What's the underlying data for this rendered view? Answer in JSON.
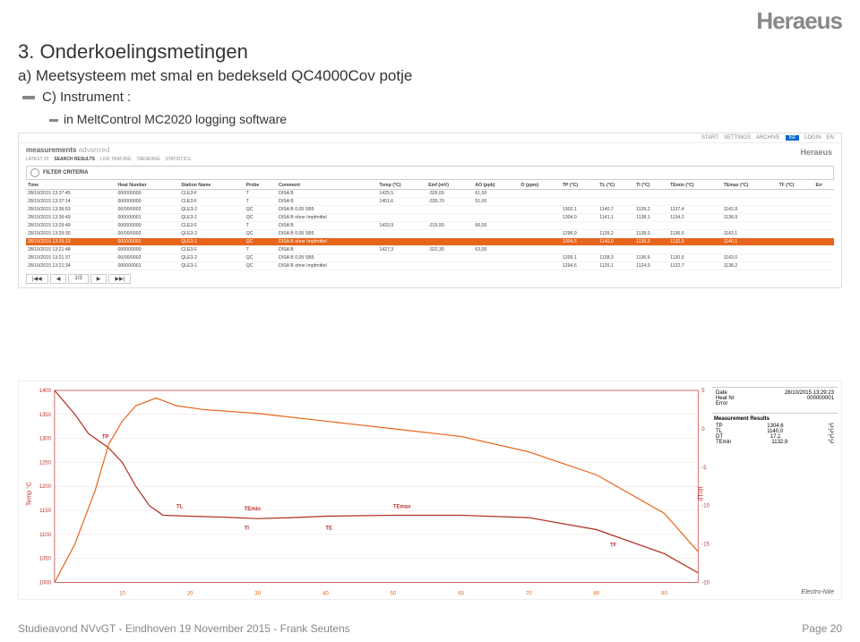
{
  "logo": "Heraeus",
  "title": "3. Onderkoelingsmetingen",
  "subtitle": "a) Meetsysteem met smal en bedekseld QC4000Cov potje",
  "bullet_c": "C) Instrument :",
  "bullet_c_sub": "in MeltControl MC2020 logging software",
  "topbar": {
    "start": "START",
    "settings": "SETTINGS",
    "archive": "ARCHIVE",
    "list": "list",
    "login": "LOGIN",
    "lang": "EN"
  },
  "breadcrumb": {
    "a": "measurements",
    "b": "advanced"
  },
  "tabs": [
    "LATEST 20",
    "SEARCH RESULTS",
    "LIVE TRACING",
    "TRENDING",
    "STATISTICS"
  ],
  "filter_label": "FILTER CRITERIA",
  "columns": [
    "Time",
    "Heat Number",
    "Station Name",
    "Probe",
    "Comment",
    "Temp (°C)",
    "Emf (mV)",
    "AO (ppb)",
    "O (ppm)",
    "TP (°C)",
    "TL (°C)",
    "TI (°C)",
    "TEmin (°C)",
    "TEmax (°C)",
    "TF (°C)",
    "Err"
  ],
  "rows": [
    {
      "time": "28/10/2015 13:37:45",
      "heat": "000000000",
      "station": "CLE3-F",
      "probe": "T",
      "comment": "DISA B",
      "temp": "1425,5",
      "emf": "-326,00",
      "ao": "61,00"
    },
    {
      "time": "28/10/2015 13:37:14",
      "heat": "000000000",
      "station": "CLE3-F",
      "probe": "T",
      "comment": "DISA B",
      "temp": "1451,6",
      "emf": "-335,70",
      "ao": "51,00"
    },
    {
      "time": "28/10/2015 13:36:53",
      "heat": "00/00/0002",
      "station": "QLE3-2",
      "probe": "QC",
      "comment": "DISA B 0,05 SB5",
      "tp": "1302,1",
      "tl": "1140,7",
      "ti": "1139,2",
      "temin": "1137,4",
      "temax": "1142,8"
    },
    {
      "time": "28/10/2015 13:36:49",
      "heat": "000000001",
      "station": "QLE3-1",
      "probe": "QC",
      "comment": "DISA B ohne Impfmittel",
      "tp": "1304,0",
      "tl": "1141,1",
      "ti": "1138,1",
      "temin": "1134,2",
      "temax": "1138,9"
    },
    {
      "time": "28/10/2015 13:29:49",
      "heat": "000000000",
      "station": "CLE3-F",
      "probe": "T",
      "comment": "DISA B",
      "temp": "1433,9",
      "emf": "-315,50",
      "ao": "66,00"
    },
    {
      "time": "28/10/2015 13:29:30",
      "heat": "00/00/0002",
      "station": "QLE3-2",
      "probe": "QC",
      "comment": "DISA B 0,05 SB5",
      "tp": "1296,9",
      "tl": "1139,2",
      "ti": "1138,0",
      "temin": "1136,6",
      "temax": "1143,1"
    },
    {
      "hl": true,
      "time": "28/10/2015 13:29:23",
      "heat": "000000001",
      "station": "QLE3-1",
      "probe": "QC",
      "comment": "DISA B ohne Impfmittel",
      "tp": "1304,5",
      "tl": "1140,0",
      "ti": "1136,9",
      "temin": "1132,9",
      "temax": "1140,1"
    },
    {
      "time": "28/10/2015 13:21:48",
      "heat": "000000000",
      "station": "CLE3-F",
      "probe": "T",
      "comment": "DISA B",
      "temp": "1427,3",
      "emf": "-322,30",
      "ao": "63,00"
    },
    {
      "time": "28/10/2015 13:21:37",
      "heat": "00/00/0002",
      "station": "QLE3-2",
      "probe": "QC",
      "comment": "DISA B 0,05 SB5",
      "tp": "1209,1",
      "tl": "1138,3",
      "ti": "1136,6",
      "temin": "1130,5",
      "temax": "1143,0"
    },
    {
      "time": "28/10/2015 13:21:34",
      "heat": "000000001",
      "station": "QLE3-1",
      "probe": "QC",
      "comment": "DISA B ohne Impfmittel",
      "tp": "1294,6",
      "tl": "1126,1",
      "ti": "1124,9",
      "temin": "1122,7",
      "temax": "1138,2"
    }
  ],
  "pager": {
    "first": "|◀◀",
    "prev": "◀",
    "page": "1/3",
    "next": "▶",
    "last": "▶▶|"
  },
  "chart_data": {
    "type": "line",
    "xlabel": "",
    "ylabel_left": "Temp °C",
    "ylabel_right": "dT/dt",
    "x_ticks": [
      10,
      20,
      30,
      40,
      50,
      60,
      70,
      80,
      90
    ],
    "y_left_ticks": [
      1000,
      1050,
      1100,
      1150,
      1200,
      1250,
      1300,
      1350,
      1400
    ],
    "y_right_ticks": [
      -20,
      -15,
      -10,
      -5,
      0,
      5
    ],
    "annotations": [
      "TP",
      "TL",
      "TEmin",
      "TI",
      "TE",
      "TEmax",
      "TF"
    ],
    "series": [
      {
        "name": "cooling",
        "color": "#b02a1e",
        "points": [
          [
            0,
            1400
          ],
          [
            3,
            1350
          ],
          [
            5,
            1310
          ],
          [
            8,
            1280
          ],
          [
            10,
            1250
          ],
          [
            12,
            1200
          ],
          [
            14,
            1160
          ],
          [
            16,
            1140
          ],
          [
            20,
            1138
          ],
          [
            25,
            1136
          ],
          [
            30,
            1133
          ],
          [
            35,
            1135
          ],
          [
            40,
            1138
          ],
          [
            50,
            1140
          ],
          [
            60,
            1140
          ],
          [
            70,
            1135
          ],
          [
            80,
            1110
          ],
          [
            90,
            1060
          ],
          [
            95,
            1020
          ]
        ]
      },
      {
        "name": "derivative",
        "color": "#e7641a",
        "points": [
          [
            0,
            -20
          ],
          [
            3,
            -15
          ],
          [
            6,
            -8
          ],
          [
            8,
            -2
          ],
          [
            10,
            1
          ],
          [
            12,
            3
          ],
          [
            15,
            4
          ],
          [
            18,
            3
          ],
          [
            22,
            2.5
          ],
          [
            30,
            2
          ],
          [
            40,
            1
          ],
          [
            50,
            0
          ],
          [
            60,
            -1
          ],
          [
            70,
            -3
          ],
          [
            80,
            -6
          ],
          [
            90,
            -11
          ],
          [
            95,
            -16
          ]
        ]
      }
    ]
  },
  "side_info": {
    "date_lbl": "Date",
    "date": "28/10/2015 13:29:23",
    "heat_lbl": "Heat Nr",
    "heat": "000000001",
    "err_lbl": "Error",
    "err": ""
  },
  "results": {
    "hdr": "Measurement Results",
    "rows": [
      [
        "TP",
        "1304,6",
        "°C"
      ],
      [
        "TL",
        "1140,0",
        "°C"
      ],
      [
        "DT",
        "17,1",
        "°C"
      ],
      [
        "TEmin",
        "1132,9",
        "°C"
      ]
    ]
  },
  "electro": "Electro-Nite",
  "footer_left": "Studieavond NVvGT - Eindhoven 19 November 2015 - Frank Seutens",
  "footer_right": "Page 20"
}
